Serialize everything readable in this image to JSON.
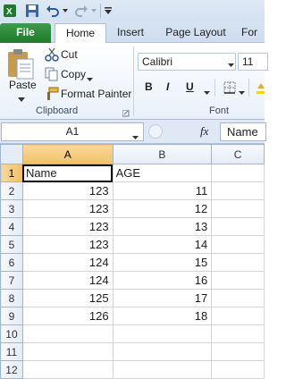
{
  "quick_access": {
    "icons": [
      "excel-icon",
      "save-icon",
      "undo-icon",
      "redo-icon",
      "customize-icon"
    ]
  },
  "tabs": [
    "File",
    "Home",
    "Insert",
    "Page Layout",
    "For"
  ],
  "ribbon": {
    "clipboard": {
      "paste_label": "Paste",
      "cut_label": "Cut",
      "copy_label": "Copy",
      "format_painter_label": "Format Painter",
      "group_label": "Clipboard"
    },
    "font": {
      "font_name": "Calibri",
      "font_size": "11",
      "group_label": "Font",
      "bold": "B",
      "italic": "I",
      "underline": "U"
    }
  },
  "formula_bar": {
    "name_box": "A1",
    "fx": "fx",
    "formula": "Name"
  },
  "sheet": {
    "columns": [
      "A",
      "B",
      "C"
    ],
    "rows": [
      {
        "n": "1",
        "a": "Name",
        "b": "AGE"
      },
      {
        "n": "2",
        "a": "123",
        "b": "11"
      },
      {
        "n": "3",
        "a": "123",
        "b": "12"
      },
      {
        "n": "4",
        "a": "123",
        "b": "13"
      },
      {
        "n": "5",
        "a": "123",
        "b": "14"
      },
      {
        "n": "6",
        "a": "124",
        "b": "15"
      },
      {
        "n": "7",
        "a": "124",
        "b": "16"
      },
      {
        "n": "8",
        "a": "125",
        "b": "17"
      },
      {
        "n": "9",
        "a": "126",
        "b": "18"
      },
      {
        "n": "10",
        "a": "",
        "b": ""
      },
      {
        "n": "11",
        "a": "",
        "b": ""
      },
      {
        "n": "12",
        "a": "",
        "b": ""
      }
    ]
  }
}
